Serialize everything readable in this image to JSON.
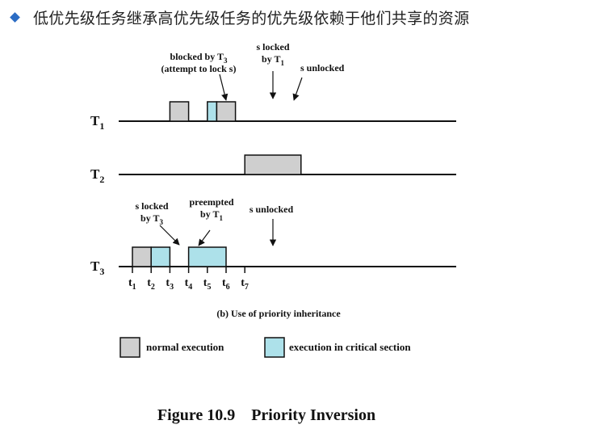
{
  "slide": {
    "heading": "低优先级任务继承高优先级任务的优先级依赖于他们共享的资源",
    "caption": "Figure 10.9    Priority Inversion"
  },
  "colors": {
    "normal": "#cfcfcf",
    "critical": "#ade1ea",
    "bullet": "#2b6cc4",
    "ink": "#111111"
  },
  "diagram": {
    "subtitle": "(b) Use of priority inheritance",
    "legend": {
      "normal": "normal execution",
      "critical": "execution in critical section"
    },
    "tasks": [
      {
        "id": "T1",
        "label": "T",
        "sub": "1"
      },
      {
        "id": "T2",
        "label": "T",
        "sub": "2"
      },
      {
        "id": "T3",
        "label": "T",
        "sub": "3"
      }
    ],
    "ticks": [
      {
        "label": "t",
        "sub": "1",
        "time": 1
      },
      {
        "label": "t",
        "sub": "2",
        "time": 2
      },
      {
        "label": "t",
        "sub": "3",
        "time": 3
      },
      {
        "label": "t",
        "sub": "4",
        "time": 4
      },
      {
        "label": "t",
        "sub": "5",
        "time": 5
      },
      {
        "label": "t",
        "sub": "6",
        "time": 6
      },
      {
        "label": "t",
        "sub": "7",
        "time": 7
      }
    ],
    "segments": [
      {
        "task": "T1",
        "start": 3.0,
        "end": 4.0,
        "kind": "normal"
      },
      {
        "task": "T1",
        "start": 5.0,
        "end": 5.5,
        "kind": "critical"
      },
      {
        "task": "T1",
        "start": 5.5,
        "end": 6.5,
        "kind": "normal"
      },
      {
        "task": "T2",
        "start": 7.0,
        "end": 10.0,
        "kind": "normal"
      },
      {
        "task": "T3",
        "start": 1.0,
        "end": 2.0,
        "kind": "normal"
      },
      {
        "task": "T3",
        "start": 2.0,
        "end": 3.0,
        "kind": "critical"
      },
      {
        "task": "T3",
        "start": 4.0,
        "end": 6.0,
        "kind": "critical"
      }
    ],
    "annotations": [
      {
        "lines": [
          [
            "blocked by T",
            "3"
          ],
          [
            "(attempt to lock s)",
            ""
          ]
        ]
      },
      {
        "lines": [
          [
            "s locked",
            ""
          ],
          [
            "by T",
            "1"
          ]
        ]
      },
      {
        "lines": [
          [
            "s unlocked",
            ""
          ]
        ]
      },
      {
        "lines": [
          [
            "s locked",
            ""
          ],
          [
            "by T",
            "3"
          ]
        ]
      },
      {
        "lines": [
          [
            "preempted",
            ""
          ],
          [
            "by T",
            "1"
          ]
        ]
      },
      {
        "lines": [
          [
            "s unlocked",
            ""
          ]
        ]
      }
    ]
  }
}
